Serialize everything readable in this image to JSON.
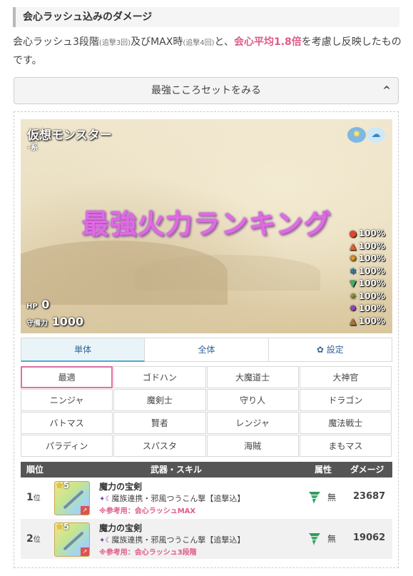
{
  "heading": "会心ラッシュ込みのダメージ",
  "desc": {
    "p1": "会心ラッシュ3段階",
    "s1": "(追撃3回)",
    "p2": "及びMAX時",
    "s2": "(追撃4回)",
    "p3": "と、",
    "highlight": "会心平均1.8倍",
    "p4": "を考慮し反映したものです。"
  },
  "accordion": {
    "label": "最強こころセットをみる",
    "chevron": "^"
  },
  "banner": {
    "monster_name": "仮想モンスター",
    "monster_type": "-系",
    "title": "最強火力ランキング",
    "hp_label": "HP",
    "hp_value": "0",
    "def_label": "守備力",
    "def_value": "1000",
    "resistances": [
      "100%",
      "100%",
      "100%",
      "100%",
      "100%",
      "100%",
      "100%",
      "100%"
    ]
  },
  "tabs": [
    "単体",
    "全体",
    "設定"
  ],
  "jobs": [
    "最適",
    "ゴドハン",
    "大魔道士",
    "大神官",
    "ニンジャ",
    "魔剣士",
    "守り人",
    "ドラゴン",
    "バトマス",
    "賢者",
    "レンジャ",
    "魔法戦士",
    "パラディン",
    "スパスタ",
    "海賊",
    "まもマス"
  ],
  "table": {
    "headers": {
      "rank": "順位",
      "weapon": "武器・スキル",
      "attr": "属性",
      "dmg": "ダメージ"
    },
    "rows": [
      {
        "rank": "1",
        "rank_suffix": "位",
        "stars": "5",
        "weapon": "魔力の宝剣",
        "skill": "魔族連携・邪風つうこん撃【追撃込】",
        "ref": "※参考用：会心ラッシュMAX",
        "attr": "無",
        "dmg": "23687"
      },
      {
        "rank": "2",
        "rank_suffix": "位",
        "stars": "5",
        "weapon": "魔力の宝剣",
        "skill": "魔族連携・邪風つうこん撃【追撃込】",
        "ref": "※参考用：会心ラッシュ3段階",
        "attr": "無",
        "dmg": "19062"
      }
    ]
  },
  "colors": {
    "accent_pink": "#e05a8a",
    "tab_active": "#e9f4f9",
    "table_header": "#555555"
  }
}
